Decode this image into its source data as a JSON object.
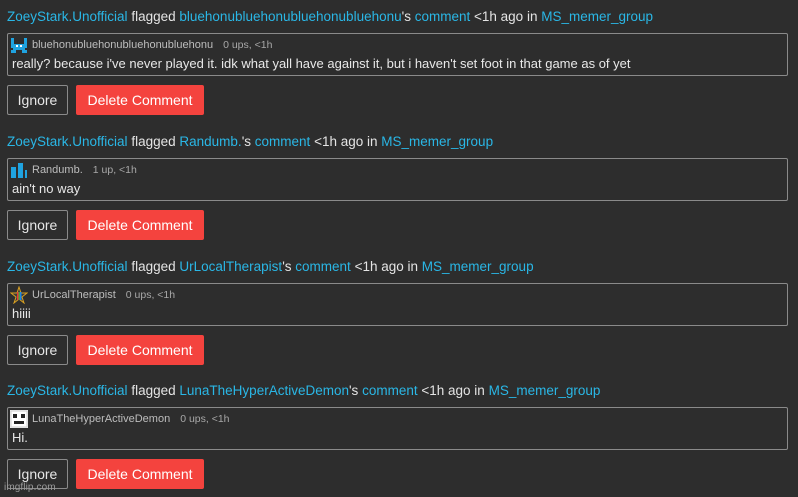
{
  "flags": [
    {
      "flagger": "ZoeyStark.Unofficial",
      "flagged_text": "flagged",
      "author": "bluehonubluehonubluehonubluehonu",
      "possessive": "'s",
      "comment_link": "comment",
      "time_in": "<1h ago in",
      "group": "MS_memer_group",
      "comment_user": "bluehonubluehonubluehonubluehonu",
      "comment_stats": "0 ups, <1h",
      "comment_text": "really? because i've never played it. idk what yall have against it, but i haven't set foot in that game as of yet",
      "avatar": "blue-creature-avatar-icon"
    },
    {
      "flagger": "ZoeyStark.Unofficial",
      "flagged_text": "flagged",
      "author": "Randumb.",
      "possessive": "'s",
      "comment_link": "comment",
      "time_in": "<1h ago in",
      "group": "MS_memer_group",
      "comment_user": "Randumb.",
      "comment_stats": "1 up, <1h",
      "comment_text": "ain't no way",
      "avatar": "blue-bars-avatar-icon"
    },
    {
      "flagger": "ZoeyStark.Unofficial",
      "flagged_text": "flagged",
      "author": "UrLocalTherapist",
      "possessive": "'s",
      "comment_link": "comment",
      "time_in": "<1h ago in",
      "group": "MS_memer_group",
      "comment_user": "UrLocalTherapist",
      "comment_stats": "0 ups, <1h",
      "comment_text": "hiiii",
      "avatar": "rainbow-star-avatar-icon"
    },
    {
      "flagger": "ZoeyStark.Unofficial",
      "flagged_text": "flagged",
      "author": "LunaTheHyperActiveDemon",
      "possessive": "'s",
      "comment_link": "comment",
      "time_in": "<1h ago in",
      "group": "MS_memer_group",
      "comment_user": "LunaTheHyperActiveDemon",
      "comment_stats": "0 ups, <1h",
      "comment_text": "Hi.",
      "avatar": "pixel-face-avatar-icon"
    }
  ],
  "buttons": {
    "ignore": "Ignore",
    "delete": "Delete Comment"
  },
  "colors": {
    "background": "#2d2d2d",
    "link": "#2ab7e6",
    "delete_button": "#f4433e",
    "border": "#8a8a8a"
  },
  "watermark": "imgflip.com"
}
